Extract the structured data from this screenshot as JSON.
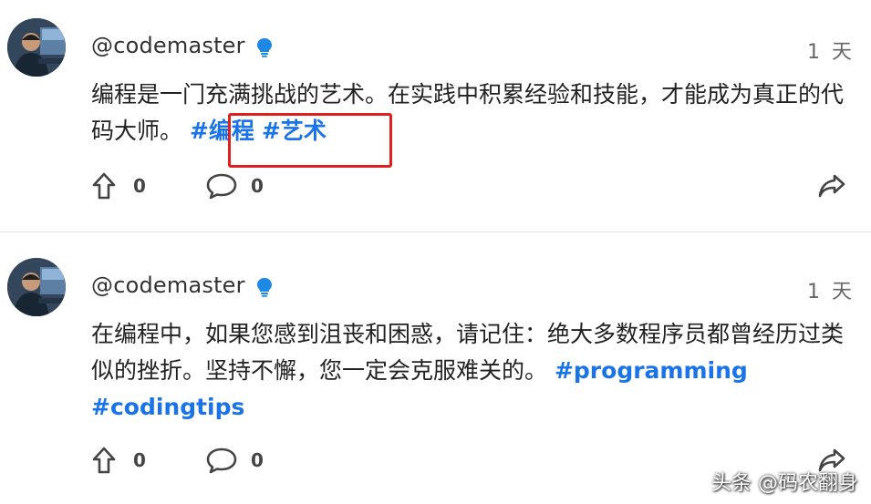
{
  "colors": {
    "hashtag": "#1a73e8",
    "highlight_box": "#e02020",
    "verified": "#1e88e5"
  },
  "posts": [
    {
      "username": "@codemaster",
      "time": "1 天",
      "text": "编程是一门充满挑战的艺术。在实践中积累经验和技能，才能成为真正的代码大师。",
      "tags": [
        "#编程",
        "#艺术"
      ],
      "upvotes": "0",
      "comments": "0"
    },
    {
      "username": "@codemaster",
      "time": "1 天",
      "text": "在编程中，如果您感到沮丧和困惑，请记住：绝大多数程序员都曾经历过类似的挫折。坚持不懈，您一定会克服难关的。",
      "tags": [
        "#programming",
        "#codingtips"
      ],
      "upvotes": "0",
      "comments": "0"
    }
  ],
  "icons": {
    "upvote": "arrow-up-icon",
    "comment": "speech-bubble-icon",
    "share": "share-arrow-icon",
    "verified": "verified-badge-icon"
  },
  "watermark": "头条 @码农翻身"
}
